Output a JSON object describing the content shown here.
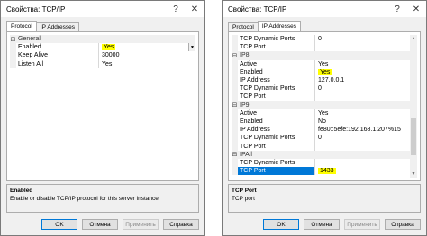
{
  "left": {
    "title": "Свойства: TCP/IP",
    "tabs": [
      "Protocol",
      "IP Addresses"
    ],
    "groups": [
      {
        "label": "General",
        "rows": [
          {
            "name": "Enabled",
            "value": "Yes",
            "highlight": true,
            "dropdown": true
          },
          {
            "name": "Keep Alive",
            "value": "30000"
          },
          {
            "name": "Listen All",
            "value": "Yes"
          }
        ]
      }
    ],
    "description": {
      "title": "Enabled",
      "text": "Enable or disable TCP/IP protocol for this server instance"
    },
    "buttons": {
      "ok": "OK",
      "cancel": "Отмена",
      "apply": "Применить",
      "help": "Справка"
    }
  },
  "right": {
    "title": "Свойства: TCP/IP",
    "tabs": [
      "Protocol",
      "IP Addresses"
    ],
    "top_rows": [
      {
        "name": "TCP Dynamic Ports",
        "value": "0"
      },
      {
        "name": "TCP Port",
        "value": ""
      }
    ],
    "groups": [
      {
        "label": "IP8",
        "rows": [
          {
            "name": "Active",
            "value": "Yes"
          },
          {
            "name": "Enabled",
            "value": "Yes",
            "highlight": true
          },
          {
            "name": "IP Address",
            "value": "127.0.0.1"
          },
          {
            "name": "TCP Dynamic Ports",
            "value": "0"
          },
          {
            "name": "TCP Port",
            "value": ""
          }
        ]
      },
      {
        "label": "IP9",
        "rows": [
          {
            "name": "Active",
            "value": "Yes"
          },
          {
            "name": "Enabled",
            "value": "No"
          },
          {
            "name": "IP Address",
            "value": "fe80::5efe:192.168.1.207%15"
          },
          {
            "name": "TCP Dynamic Ports",
            "value": "0"
          },
          {
            "name": "TCP Port",
            "value": ""
          }
        ]
      },
      {
        "label": "IPAll",
        "rows": [
          {
            "name": "TCP Dynamic Ports",
            "value": ""
          },
          {
            "name": "TCP Port",
            "value": "1433",
            "highlight": true,
            "selected": true
          }
        ]
      }
    ],
    "description": {
      "title": "TCP Port",
      "text": "TCP port"
    },
    "buttons": {
      "ok": "OK",
      "cancel": "Отмена",
      "apply": "Применить",
      "help": "Справка"
    }
  },
  "colors": {
    "highlight": "#ffff00",
    "selection": "#0078d7"
  }
}
